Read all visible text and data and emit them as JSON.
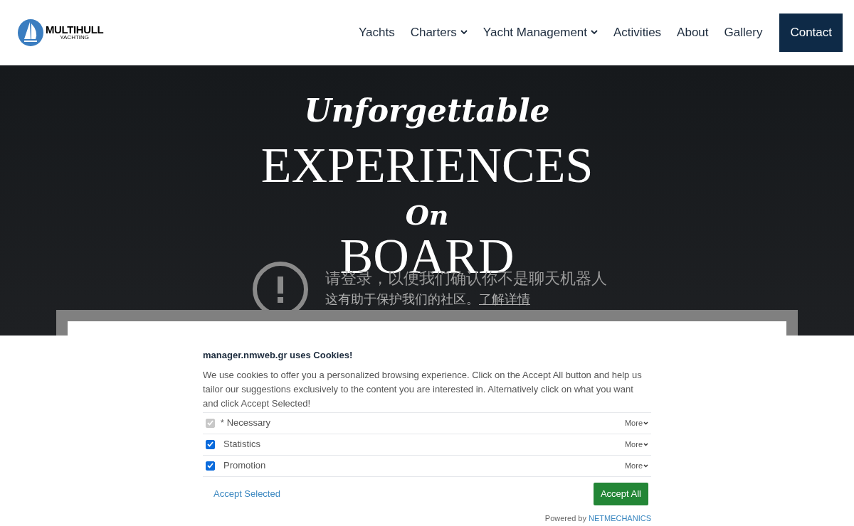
{
  "header": {
    "logo": {
      "title": "MULTIHULL",
      "subtitle": "YACHTING"
    },
    "nav": [
      {
        "label": "Yachts",
        "dropdown": false
      },
      {
        "label": "Charters",
        "dropdown": true
      },
      {
        "label": "Yacht Management",
        "dropdown": true
      },
      {
        "label": "Activities",
        "dropdown": false
      },
      {
        "label": "About",
        "dropdown": false
      },
      {
        "label": "Gallery",
        "dropdown": false
      }
    ],
    "contact_button": "Contact"
  },
  "hero": {
    "line_1": "Unforgettable",
    "line_2": "EXPERIENCES",
    "line_3": "On",
    "line_4": "BOARD"
  },
  "notice": {
    "title": "请登录，以便我们确认你不是聊天机器人",
    "text": "这有助于保护我们的社区。",
    "link": "了解详情"
  },
  "cookies": {
    "title": "manager.nmweb.gr uses Cookies!",
    "text": "We use cookies to offer you a personalized browsing experience. Click on the Accept All button and help us tailor our suggestions exclusively to the content you are interested in. Alternatively click on what you want and click Accept Selected!",
    "options": [
      {
        "label": "Necessary",
        "prefix": "*",
        "checked": true,
        "disabled": true,
        "more": "More"
      },
      {
        "label": "Statistics",
        "checked": true,
        "disabled": false,
        "more": "More"
      },
      {
        "label": "Promotion",
        "checked": true,
        "disabled": false,
        "more": "More"
      }
    ],
    "accept_selected": "Accept Selected",
    "accept_all": "Accept All",
    "powered_by": "Powered by",
    "powered_link": "NETMECHANICS"
  }
}
